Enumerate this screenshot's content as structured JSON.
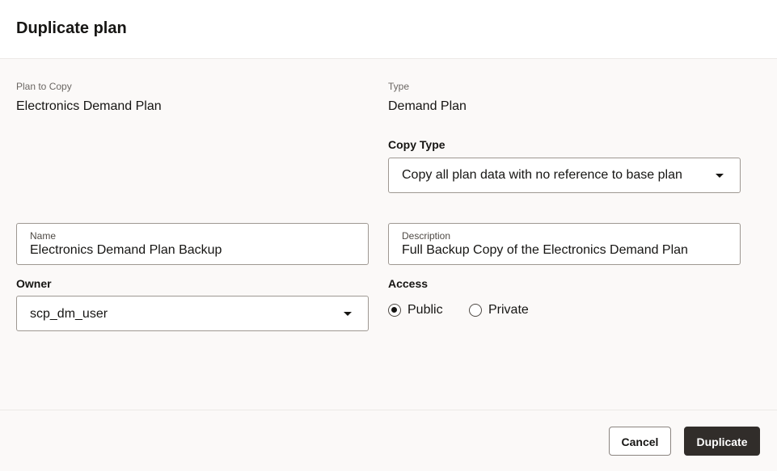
{
  "dialog": {
    "title": "Duplicate plan"
  },
  "plan_to_copy": {
    "label": "Plan to Copy",
    "value": "Electronics Demand Plan"
  },
  "type": {
    "label": "Type",
    "value": "Demand Plan"
  },
  "copy_type": {
    "label": "Copy Type",
    "selected": "Copy all plan data with no reference to base plan"
  },
  "name": {
    "label": "Name",
    "value": "Electronics Demand Plan Backup"
  },
  "description": {
    "label": "Description",
    "value": "Full Backup Copy of the Electronics Demand Plan"
  },
  "owner": {
    "label": "Owner",
    "selected": "scp_dm_user"
  },
  "access": {
    "label": "Access",
    "options": [
      {
        "label": "Public",
        "checked": true
      },
      {
        "label": "Private",
        "checked": false
      }
    ]
  },
  "footer": {
    "cancel_label": "Cancel",
    "duplicate_label": "Duplicate"
  },
  "colors": {
    "primary_button_bg": "#312d2a",
    "page_bg": "#fbf9f8",
    "field_border": "#9e9892"
  },
  "icons": {
    "dropdown": "chevron-down-icon",
    "radio_checked": "radio-checked-icon",
    "radio_unchecked": "radio-unchecked-icon"
  }
}
